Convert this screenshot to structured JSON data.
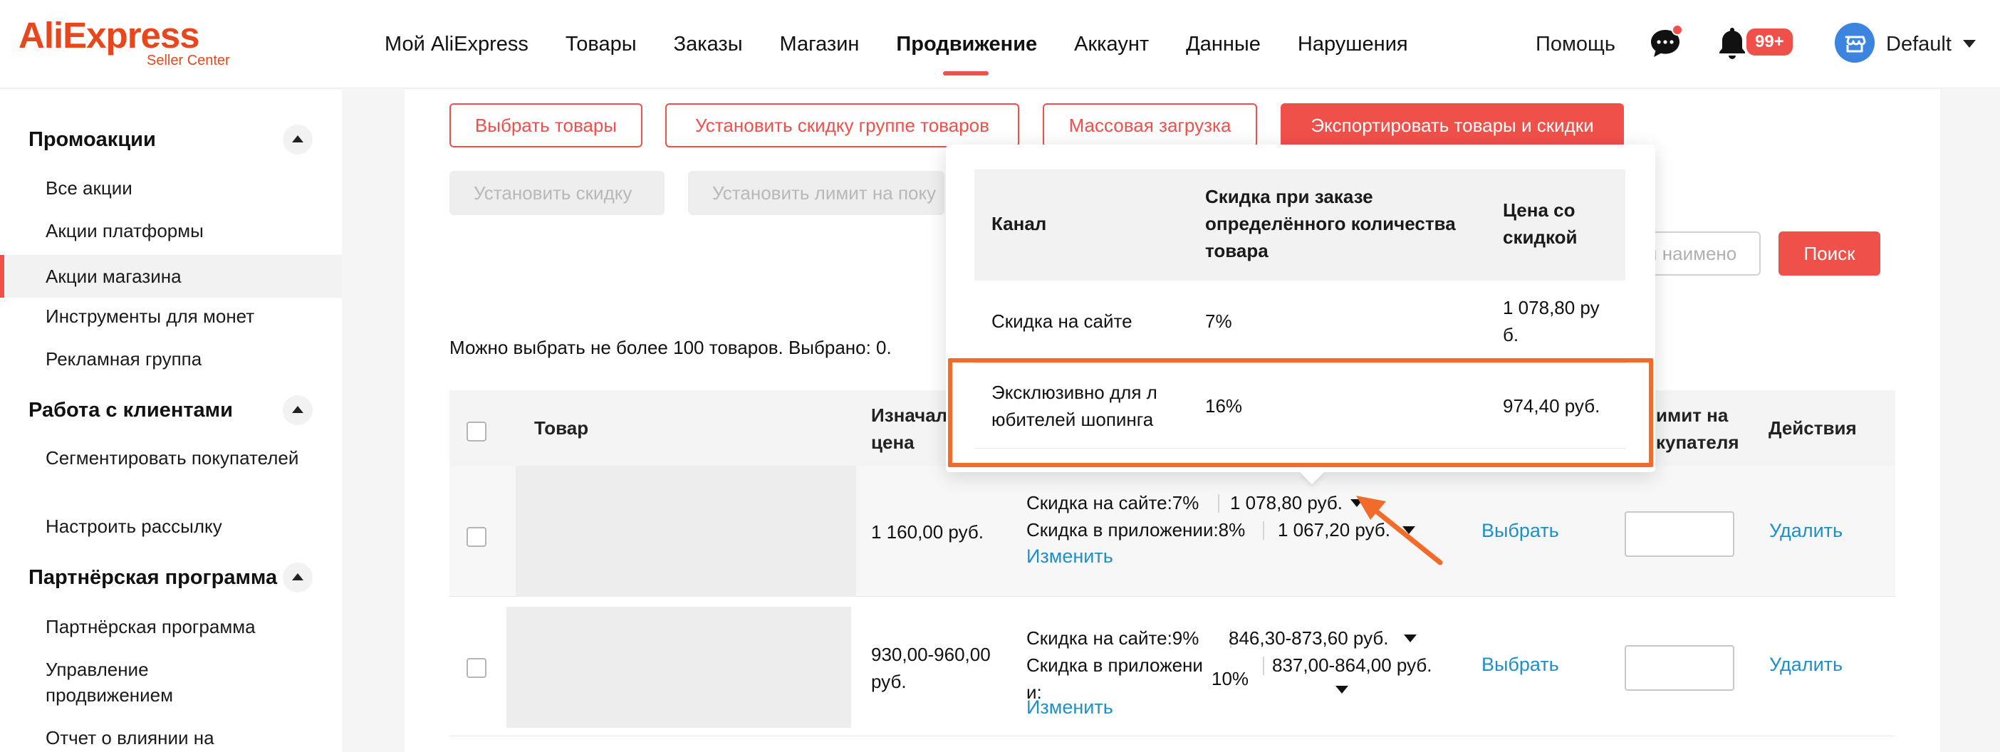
{
  "logo": {
    "text": "AliExpress",
    "sub": "Seller Center"
  },
  "nav": [
    {
      "label": "Мой AliExpress",
      "active": false
    },
    {
      "label": "Товары",
      "active": false
    },
    {
      "label": "Заказы",
      "active": false
    },
    {
      "label": "Магазин",
      "active": false
    },
    {
      "label": "Продвижение",
      "active": true
    },
    {
      "label": "Аккаунт",
      "active": false
    },
    {
      "label": "Данные",
      "active": false
    },
    {
      "label": "Нарушения",
      "active": false
    }
  ],
  "header": {
    "help": "Помощь",
    "badge": "99+",
    "account": "Default"
  },
  "sidebar": {
    "promo": {
      "title": "Промоакции",
      "items": [
        "Все акции",
        "Акции платформы",
        "Акции магазина",
        "Инструменты для монет",
        "Рекламная группа"
      ]
    },
    "clients": {
      "title": "Работа с клиентами",
      "items": [
        "Сегментировать покупателей",
        "Настроить рассылку"
      ]
    },
    "partner": {
      "title": "Партнёрская программа",
      "items": [
        "Партнёрская программа",
        "Управление продвижением",
        "Отчет о влиянии на"
      ]
    }
  },
  "toolbar": {
    "select_products": "Выбрать товары",
    "group_discount": "Установить скидку группе товаров",
    "bulk_upload": "Массовая загрузка",
    "export": "Экспортировать товары и скидки",
    "set_discount": "Установить скидку",
    "set_limit": "Установить лимит на поку"
  },
  "search": {
    "placeholder": "и наимено",
    "button": "Поиск"
  },
  "hint": "Можно выбрать не более 100 товаров. Выбрано: 0.",
  "table": {
    "headers": {
      "product": "Товар",
      "orig_price_1": "Изначал",
      "orig_price_2": "цена",
      "limit_1": "имит на",
      "limit_2": "купателя",
      "actions": "Действия"
    },
    "rows": [
      {
        "orig_price": "1 160,00 руб.",
        "site_label": "Скидка на сайте:7%",
        "site_price": "1 078,80 руб.",
        "app_label": "Скидка в приложении:8%",
        "app_price": "1 067,20 руб.",
        "edit": "Изменить",
        "select": "Выбрать",
        "delete": "Удалить"
      },
      {
        "orig_price_1": "930,00-960,00",
        "orig_price_2": "руб.",
        "site_label": "Скидка на сайте:9%",
        "site_price": "846,30-873,60 руб.",
        "app_label_1": "Скидка в приложени",
        "app_label_2": "и:",
        "app_pct": "10%",
        "app_price": "837,00-864,00 руб.",
        "edit": "Изменить",
        "select": "Выбрать",
        "delete": "Удалить"
      }
    ]
  },
  "popover": {
    "headers": {
      "channel": "Канал",
      "qty_1": "Скидка при заказе",
      "qty_2": "определённого количества",
      "qty_3": "товара",
      "price_1": "Цена со",
      "price_2": "скидкой"
    },
    "rows": [
      {
        "channel": "Скидка на сайте",
        "pct": "7%",
        "price_1": "1 078,80 ру",
        "price_2": "б."
      },
      {
        "channel_1": "Эксклюзивно для л",
        "channel_2": "юбителей шопинга",
        "pct": "16%",
        "price": "974,40 руб."
      }
    ]
  },
  "colors": {
    "accent": "#f0504a",
    "link": "#1f8fc8",
    "highlight": "#f26b2a",
    "logo": "#e8471d"
  }
}
